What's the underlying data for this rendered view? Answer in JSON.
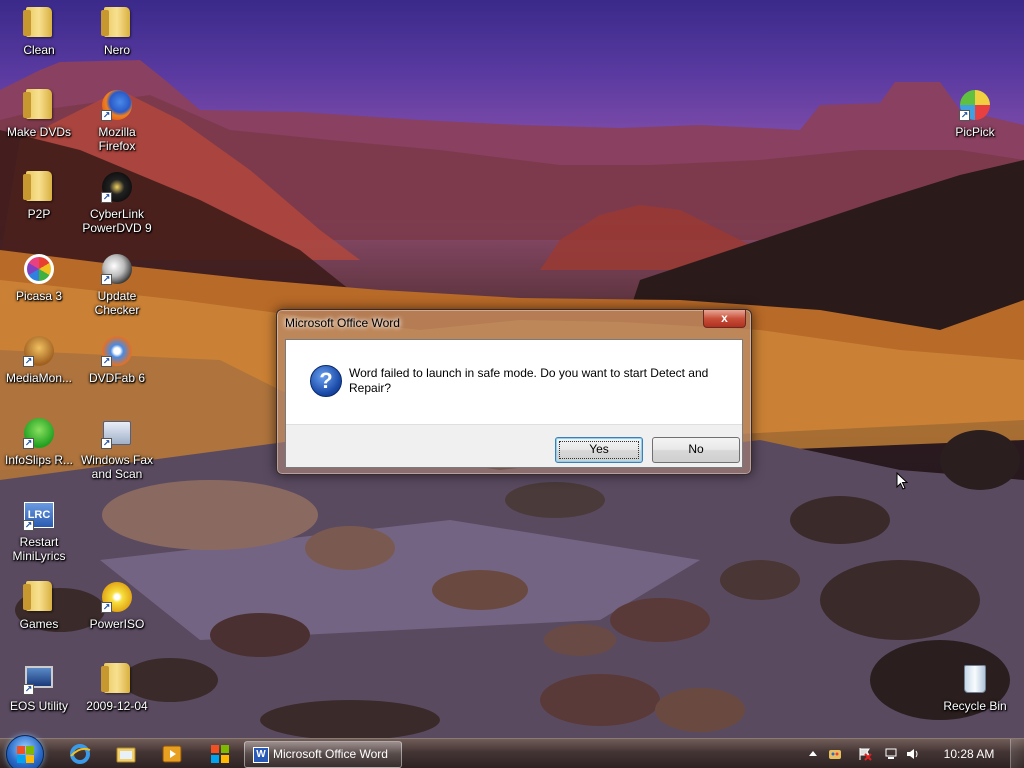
{
  "desktop": {
    "icons": [
      {
        "label": "Clean",
        "icon": "folder-icon"
      },
      {
        "label": "Nero",
        "icon": "folder-icon"
      },
      {
        "label": "Make DVDs",
        "icon": "folder-icon"
      },
      {
        "label": "Mozilla Firefox",
        "line1": "Mozilla",
        "line2": "Firefox",
        "icon": "firefox-icon"
      },
      {
        "label": "P2P",
        "icon": "folder-icon"
      },
      {
        "label": "CyberLink PowerDVD 9",
        "line1": "CyberLink",
        "line2": "PowerDVD 9",
        "icon": "powerdvd-icon"
      },
      {
        "label": "Picasa 3",
        "icon": "picasa-icon"
      },
      {
        "label": "Update Checker",
        "line1": "Update",
        "line2": "Checker",
        "icon": "update-checker-icon"
      },
      {
        "label": "MediaMon...",
        "icon": "mediamonkey-icon"
      },
      {
        "label": "DVDFab 6",
        "icon": "dvdfab-icon"
      },
      {
        "label": "InfoSlips R...",
        "icon": "infoslips-icon"
      },
      {
        "label": "Windows Fax and Scan",
        "line1": "Windows Fax",
        "line2": "and Scan",
        "icon": "fax-scan-icon"
      },
      {
        "label": "Restart MiniLyrics",
        "line1": "Restart",
        "line2": "MiniLyrics",
        "icon": "minilyrics-icon"
      },
      {
        "label": "Games",
        "icon": "folder-icon"
      },
      {
        "label": "PowerISO",
        "icon": "poweriso-icon"
      },
      {
        "label": "EOS Utility",
        "icon": "eos-utility-icon"
      },
      {
        "label": "2009-12-04",
        "icon": "folder-icon"
      },
      {
        "label": "PicPick",
        "icon": "picpick-icon"
      },
      {
        "label": "Recycle Bin",
        "icon": "recycle-bin-icon"
      }
    ]
  },
  "dialog": {
    "title": "Microsoft Office Word",
    "close_glyph": "x",
    "icon": "question-icon",
    "message": "Word failed to launch in safe mode. Do you want to start Detect and Repair?",
    "buttons": {
      "yes": "Yes",
      "no": "No"
    }
  },
  "taskbar": {
    "pinned": [
      "internet-explorer-icon",
      "windows-explorer-icon",
      "media-player-icon",
      "windows-logo-icon"
    ],
    "active_task": {
      "label": "Microsoft Office Word",
      "icon": "word-icon"
    },
    "tray_icons": [
      "show-hidden-icons-icon",
      "paint-icon",
      "action-center-icon",
      "network-icon",
      "volume-icon"
    ],
    "clock": "10:28 AM"
  },
  "colors": {
    "dialog_message_text": "#000000",
    "close_button": "#c8503a",
    "default_button_border": "#3c7fb1",
    "icon_label_text": "#ffffff"
  }
}
